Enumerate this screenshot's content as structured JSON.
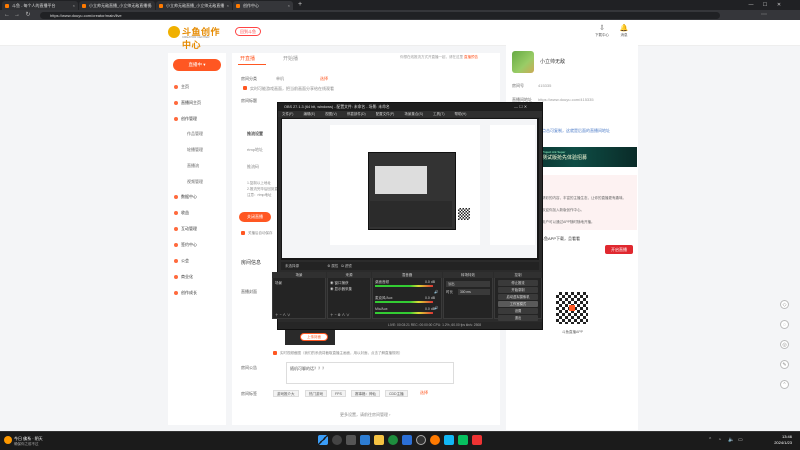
{
  "browser": {
    "tabs": [
      {
        "label": "斗鱼 - 每个人的直播平台"
      },
      {
        "label": "小立帅无敌直播_小立帅无敌直播视"
      },
      {
        "label": "小立帅无敌直播_小立帅无敌直播"
      },
      {
        "label": "创作中心"
      }
    ],
    "url": "https://www.douyu.com/creator/main/live"
  },
  "header": {
    "logo_text": "斗鱼创作中心",
    "logo_sub": "CREATOR CENTER",
    "top_button": "回到斗鱼",
    "icons": [
      {
        "label": "下载中心"
      },
      {
        "label": "消息"
      }
    ]
  },
  "sidebar": {
    "live_button": "直播中 ▾",
    "items": [
      {
        "label": "主页",
        "sub": false
      },
      {
        "label": "直播间主页",
        "sub": false
      },
      {
        "label": "创作管理",
        "sub": false
      },
      {
        "label": "作品管理",
        "sub": true
      },
      {
        "label": "轮播管理",
        "sub": true
      },
      {
        "label": "直播流",
        "sub": true
      },
      {
        "label": "视频管理",
        "sub": true
      },
      {
        "label": "数据中心",
        "sub": false
      },
      {
        "label": "收益",
        "sub": false
      },
      {
        "label": "互动管理",
        "sub": false
      },
      {
        "label": "签约中心",
        "sub": false
      },
      {
        "label": "公会",
        "sub": false
      },
      {
        "label": "商业化",
        "sub": false
      },
      {
        "label": "创作成长",
        "sub": false
      }
    ]
  },
  "main": {
    "tab_open": "开直播",
    "tab_start": "开始播",
    "top_note": "你想在线推流方式开直播一起，请在这里",
    "top_link": "直播预告",
    "rows": [
      {
        "label": "房间分类",
        "value": "单机",
        "extra": "选择"
      },
      {
        "label": "房间标题",
        "value": ""
      }
    ],
    "checkbox1": "实时可能游戏画面，把当前画面分享给在线观看",
    "push_title": "推流设置",
    "push_labels": [
      "rtmp地址",
      "推流码"
    ],
    "steps": [
      "1.复制以上地址",
      "2.推流完毕后回到直播",
      "注意：rtmp地址"
    ],
    "stream_button": "关闭直播",
    "checkbox2": "关播后自动保存",
    "room_info_title": "房间信息",
    "cover_label": "直播封面",
    "cover_button": "上传封面",
    "checkbox3": "实时视频截图（我们的系统将截取直播主画面，用以封面，点击了解直播规则）",
    "notice_label": "房间公告",
    "notice_text": "随机可聊的话？？？",
    "tags_label": "房间标签",
    "tags": [
      "游戏推介大",
      "热门游戏",
      "FPS",
      "赛事格：神仙",
      "CDD主播"
    ],
    "tags_link": "选择",
    "more_link": "更多设置，请前往房间管理 ›"
  },
  "right": {
    "username": "小立帅无敌",
    "room_label": "房间号",
    "room_id": "415335",
    "url_label": "直播间地址",
    "url_text": "https://www.douyu.com/415335",
    "link": "点击可复制，这就是后面的直播间地址",
    "banner_title": "测试版抢先体验招募",
    "banner_sub": "Project Ark Super",
    "tips": [
      "精彩的内容，丰富的主播生态，让你的直播更有趣味。",
      "欢迎你加入新版创作中心。",
      "用户可以通过APP随时随地开播。"
    ],
    "join_text": "斗鱼APP下载，且看看",
    "red_button": "开启直播",
    "qr_text": "斗鱼直播APP"
  },
  "obs": {
    "title": "OBS 27.1.3 (64 bit, windows) - 配置文件: 未命名 - 场景: 未命名",
    "menu": [
      "文件(F)",
      "编辑(E)",
      "视图(V)",
      "停靠部件(D)",
      "配置文件(P)",
      "场景集合(S)",
      "工具(T)",
      "帮助(H)"
    ],
    "bar_labels": [
      "未选择源",
      "属性",
      "滤镜"
    ],
    "docks": {
      "scenes": "场景",
      "sources": "来源",
      "mixer": "混音器",
      "transitions": "转场特效",
      "controls": "控制"
    },
    "scene_item": "场景",
    "sources": [
      "窗口捕获",
      "显示器采集"
    ],
    "mixer": [
      {
        "name": "桌面音频",
        "db": "0.0 dB"
      },
      {
        "name": "麦克风/Aux",
        "db": "0.0 dB"
      },
      {
        "name": "Mic/Aux",
        "db": "0.0 dB"
      }
    ],
    "transition": "淡出",
    "duration_label": "时长",
    "duration": "300 ms",
    "controls": [
      "停止推流",
      "开始录制",
      "启动虚拟摄像机",
      "工作室模式",
      "设置",
      "退出"
    ],
    "status": "LIVE: 00:03:21   REC: 00:00:00   CPU: 1.2%, 60.00 fps   kb/s: 2508"
  },
  "taskbar": {
    "weather_title": "今日 佛系 · 阴天",
    "weather_sub": "确保你之前不过",
    "time": "13:46",
    "date": "2024/1/23"
  },
  "colors": {
    "accent": "#ff5722",
    "obs_bg": "#2b2b2b",
    "taskbar": "#1b1b1b"
  }
}
